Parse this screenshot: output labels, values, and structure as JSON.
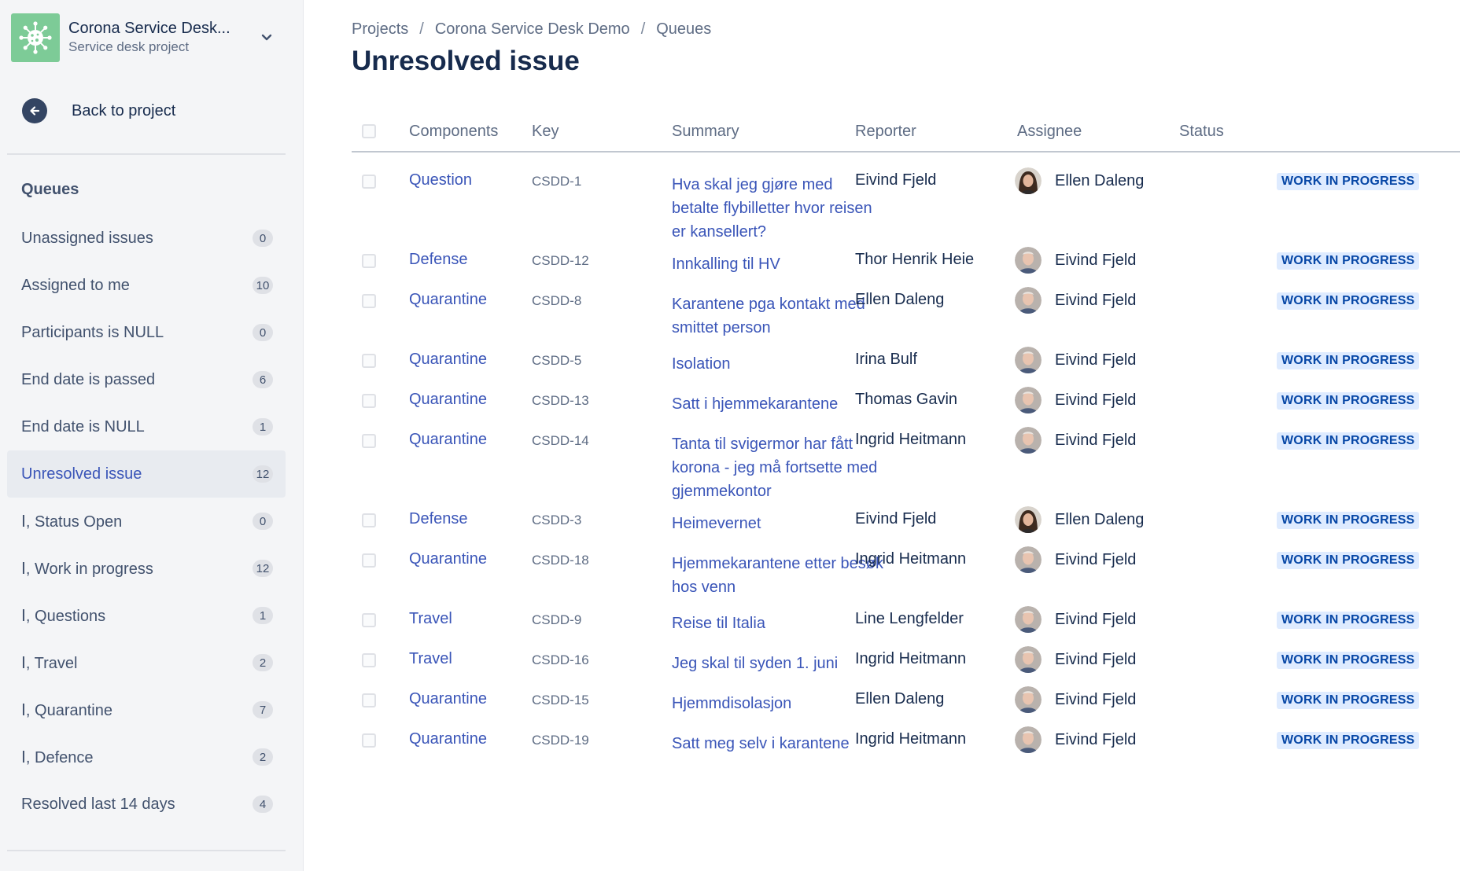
{
  "sidebar": {
    "project_name": "Corona Service Desk...",
    "project_type": "Service desk project",
    "back_label": "Back to project",
    "queues_heading": "Queues",
    "queues": [
      {
        "label": "Unassigned issues",
        "count": "0"
      },
      {
        "label": "Assigned to me",
        "count": "10"
      },
      {
        "label": "Participants is NULL",
        "count": "0"
      },
      {
        "label": "End date is passed",
        "count": "6"
      },
      {
        "label": "End date is NULL",
        "count": "1"
      },
      {
        "label": "Unresolved issue",
        "count": "12"
      },
      {
        "label": "Status Open",
        "count": "0"
      },
      {
        "label": "Work in progress",
        "count": "12"
      },
      {
        "label": "Questions",
        "count": "1"
      },
      {
        "label": "Travel",
        "count": "2"
      },
      {
        "label": "Quarantine",
        "count": "7"
      },
      {
        "label": "Defence",
        "count": "2"
      },
      {
        "label": "Resolved last 14 days",
        "count": "4"
      }
    ],
    "sub_prefix": "Ⅰ,"
  },
  "breadcrumb": [
    "Projects",
    "Corona Service Desk Demo",
    "Queues"
  ],
  "page_title": "Unresolved issue",
  "table": {
    "headers": {
      "components": "Components",
      "key": "Key",
      "summary": "Summary",
      "reporter": "Reporter",
      "assignee": "Assignee",
      "status": "Status"
    },
    "rows": [
      {
        "component": "Question",
        "key": "CSDD-1",
        "summary": "Hva skal jeg gjøre med betalte flybilletter hvor reisen er kansellert?",
        "reporter": "Eivind Fjeld",
        "assignee": "Ellen Daleng",
        "status": "WORK IN PROGRESS"
      },
      {
        "component": "Defense",
        "key": "CSDD-12",
        "summary": "Innkalling til HV",
        "reporter": "Thor Henrik Heie",
        "assignee": "Eivind Fjeld",
        "status": "WORK IN PROGRESS"
      },
      {
        "component": "Quarantine",
        "key": "CSDD-8",
        "summary": "Karantene pga kontakt med smittet person",
        "reporter": "Ellen Daleng",
        "assignee": "Eivind Fjeld",
        "status": "WORK IN PROGRESS"
      },
      {
        "component": "Quarantine",
        "key": "CSDD-5",
        "summary": "Isolation",
        "reporter": "Irina Bulf",
        "assignee": "Eivind Fjeld",
        "status": "WORK IN PROGRESS"
      },
      {
        "component": "Quarantine",
        "key": "CSDD-13",
        "summary": "Satt i hjemmekarantene",
        "reporter": "Thomas Gavin",
        "assignee": "Eivind Fjeld",
        "status": "WORK IN PROGRESS"
      },
      {
        "component": "Quarantine",
        "key": "CSDD-14",
        "summary": "Tanta til svigermor har fått korona - jeg må fortsette med gjemmekontor",
        "reporter": "Ingrid Heitmann",
        "assignee": "Eivind Fjeld",
        "status": "WORK IN PROGRESS"
      },
      {
        "component": "Defense",
        "key": "CSDD-3",
        "summary": "Heimevernet",
        "reporter": "Eivind Fjeld",
        "assignee": "Ellen Daleng",
        "status": "WORK IN PROGRESS"
      },
      {
        "component": "Quarantine",
        "key": "CSDD-18",
        "summary": "Hjemmekarantene etter besøk hos venn",
        "reporter": "Ingrid Heitmann",
        "assignee": "Eivind Fjeld",
        "status": "WORK IN PROGRESS"
      },
      {
        "component": "Travel",
        "key": "CSDD-9",
        "summary": "Reise til Italia",
        "reporter": "Line Lengfelder",
        "assignee": "Eivind Fjeld",
        "status": "WORK IN PROGRESS"
      },
      {
        "component": "Travel",
        "key": "CSDD-16",
        "summary": "Jeg skal til syden 1. juni",
        "reporter": "Ingrid Heitmann",
        "assignee": "Eivind Fjeld",
        "status": "WORK IN PROGRESS"
      },
      {
        "component": "Quarantine",
        "key": "CSDD-15",
        "summary": "Hjemmdisolasjon",
        "reporter": "Ellen Daleng",
        "assignee": "Eivind Fjeld",
        "status": "WORK IN PROGRESS"
      },
      {
        "component": "Quarantine",
        "key": "CSDD-19",
        "summary": "Satt meg selv i karantene",
        "reporter": "Ingrid Heitmann",
        "assignee": "Eivind Fjeld",
        "status": "WORK IN PROGRESS"
      }
    ]
  },
  "colors": {
    "link": "#3A55B8",
    "status_bg": "#DEEBFF",
    "status_text": "#0747A6",
    "logo_bg": "#7DCB97"
  },
  "icons": {
    "project_logo": "virus-icon",
    "chevron": "chevron-down-icon",
    "back": "arrow-left-icon"
  }
}
